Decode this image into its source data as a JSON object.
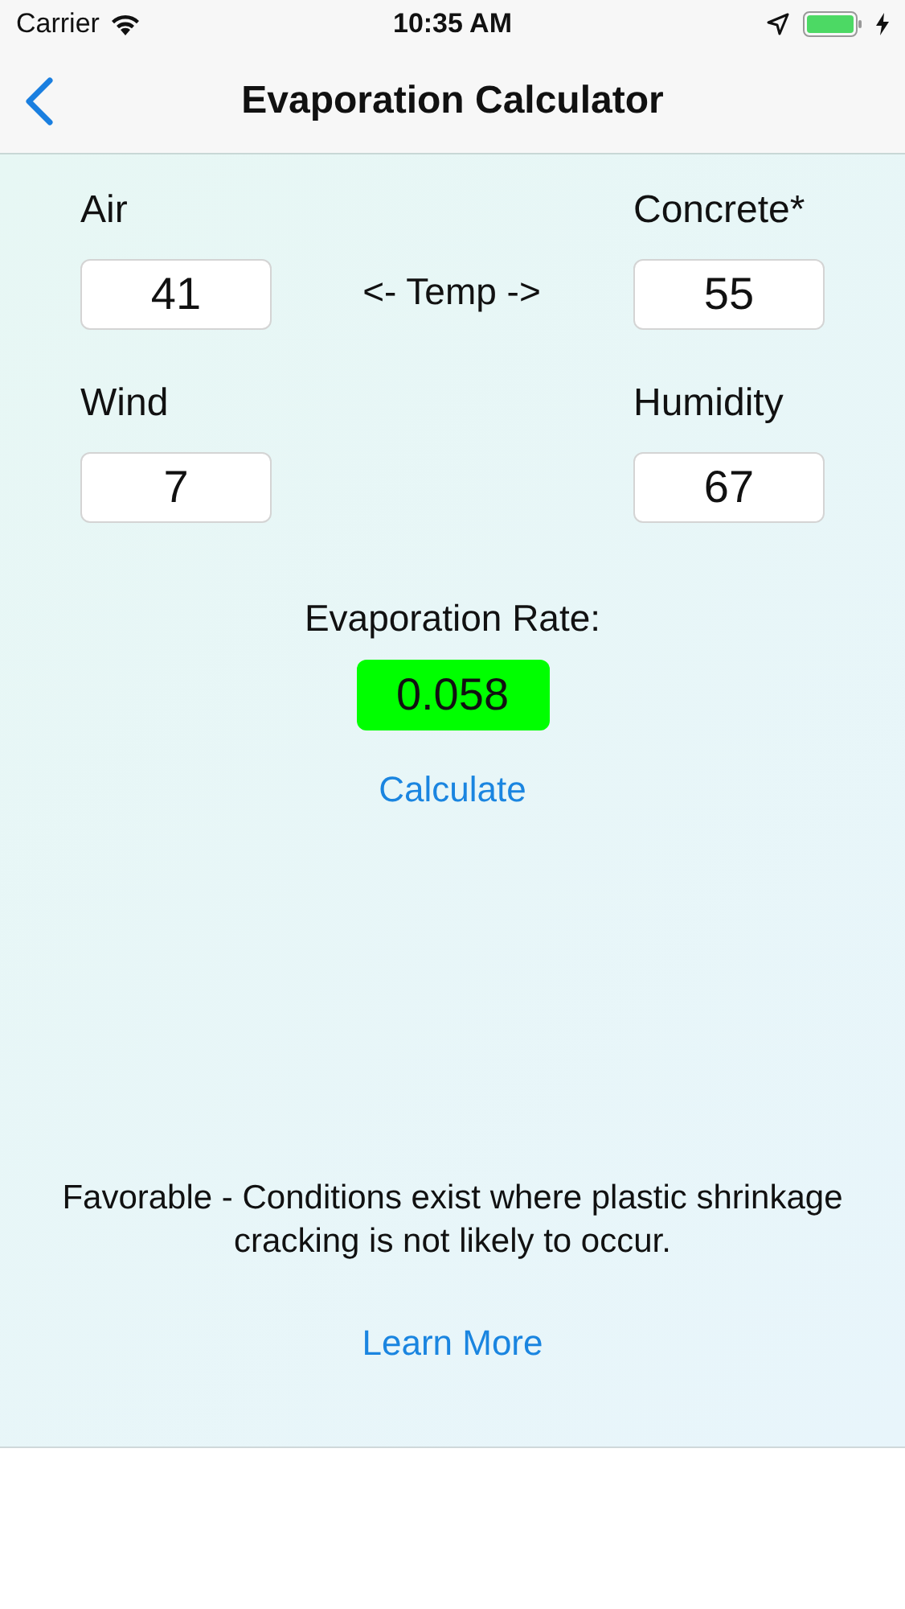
{
  "status_bar": {
    "carrier": "Carrier",
    "time": "10:35 AM"
  },
  "nav": {
    "title": "Evaporation Calculator"
  },
  "fields": [
    {
      "label": "Air",
      "value": "41"
    },
    {
      "label": "Concrete*",
      "value": "55"
    },
    {
      "label": "Wind",
      "value": "7"
    },
    {
      "label": "Humidity",
      "value": "67"
    }
  ],
  "temp_label": "<- Temp ->",
  "result": {
    "label": "Evaporation Rate:",
    "value": "0.058",
    "color": "#00ff00"
  },
  "calculate_link": "Calculate",
  "message": "Favorable - Conditions exist where plastic shrinkage cracking is not likely to occur.",
  "learn_more_link": "Learn More"
}
